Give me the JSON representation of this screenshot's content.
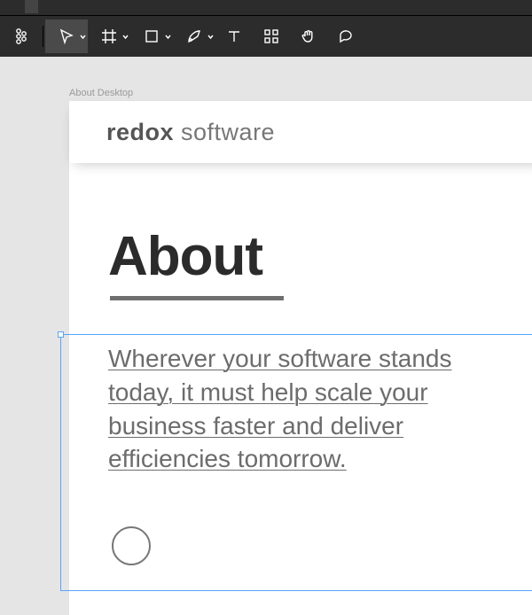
{
  "toolbar": {
    "tools": [
      {
        "name": "figma-menu",
        "chev": false
      },
      {
        "name": "move",
        "chev": true,
        "active": true
      },
      {
        "name": "frame",
        "chev": true
      },
      {
        "name": "shape",
        "chev": true
      },
      {
        "name": "pen",
        "chev": true
      },
      {
        "name": "text",
        "chev": false
      },
      {
        "name": "resources",
        "chev": false
      },
      {
        "name": "hand",
        "chev": false
      },
      {
        "name": "comment",
        "chev": false
      }
    ]
  },
  "canvas": {
    "frame_label": "About Desktop",
    "brand_bold": "redox",
    "brand_light": " software",
    "page_title": "About",
    "lede_text": "Wherever your software stands today, it must help scale your business faster and deliver efficiencies tomorrow."
  }
}
